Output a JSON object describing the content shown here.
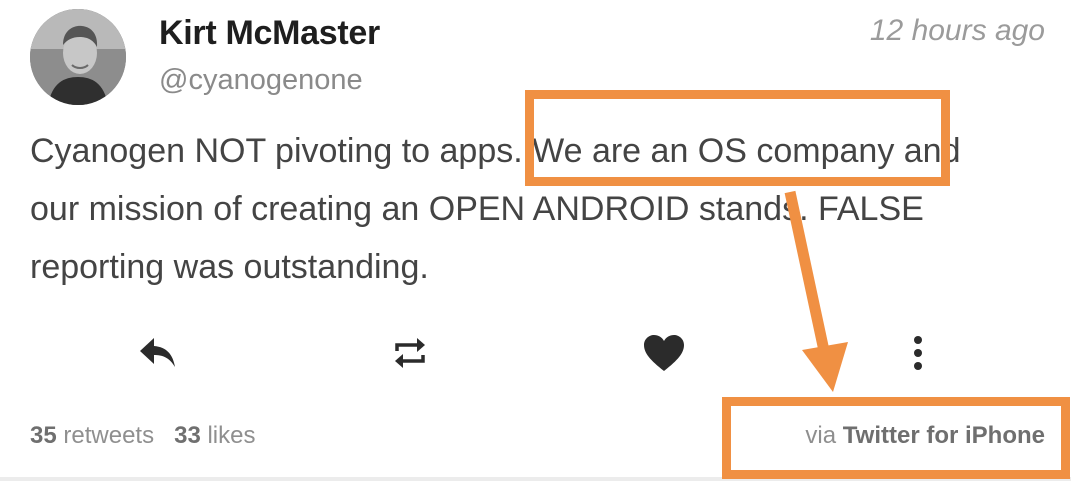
{
  "author": {
    "name": "Kirt McMaster",
    "handle": "@cyanogenone"
  },
  "timestamp": "12 hours ago",
  "tweet": {
    "lines": [
      "Cyanogen NOT pivoting to apps. We are an OS company and",
      "our mission of creating an OPEN ANDROID stands. FALSE",
      "reporting was outstanding."
    ]
  },
  "actions": {
    "icons": [
      "reply-icon",
      "retweet-icon",
      "heart-icon",
      "more-options-icon"
    ]
  },
  "stats": {
    "retweet_count": "35",
    "retweet_label": "retweets",
    "like_count": "33",
    "like_label": "likes"
  },
  "source": {
    "prefix": "via",
    "client": "Twitter for iPhone"
  },
  "colors": {
    "annotation": "#f09043",
    "icon": "#2b2b2b"
  }
}
